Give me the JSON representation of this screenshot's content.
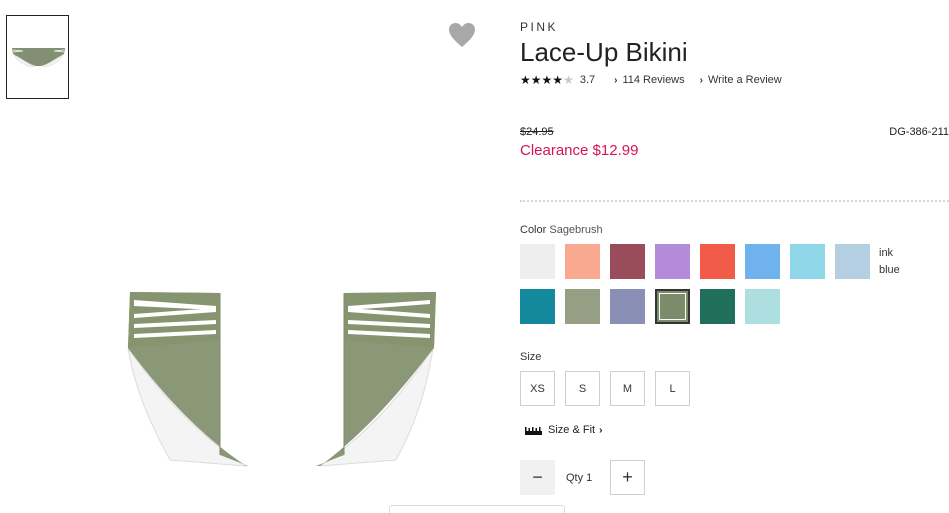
{
  "product": {
    "brand": "PINK",
    "title": "Lace-Up Bikini",
    "rating_stars_filled": 4,
    "rating_stars_total": 5,
    "rating_value": "3.7",
    "reviews_link": "114 Reviews",
    "write_review_link": "Write a Review",
    "original_price": "$24.95",
    "sale_price": "Clearance $12.99",
    "sku": "DG-386-211"
  },
  "color": {
    "label": "Color",
    "selected": "Sagebrush",
    "tooltip_line1": "ink",
    "tooltip_line2": "blue",
    "swatches_row1": [
      {
        "name": "white-marble",
        "color": "#eeeeee"
      },
      {
        "name": "coral",
        "color": "#f9a98f"
      },
      {
        "name": "plum",
        "color": "#9a4c5a"
      },
      {
        "name": "purple-floral",
        "color": "#b38bd8"
      },
      {
        "name": "red-tropical",
        "color": "#f25a4a"
      },
      {
        "name": "blue-watercolor",
        "color": "#6fb2ee"
      },
      {
        "name": "tie-dye",
        "color": "#8fd6e8"
      },
      {
        "name": "ink-blue",
        "color": "#b3cfe1"
      }
    ],
    "swatches_row2": [
      {
        "name": "teal",
        "color": "#14889c"
      },
      {
        "name": "sage",
        "color": "#969f84"
      },
      {
        "name": "feather-print",
        "color": "#8a8fb6"
      },
      {
        "name": "sagebrush",
        "color": "#7c8b6a",
        "selected": true
      },
      {
        "name": "green-palm",
        "color": "#1f6f5c"
      },
      {
        "name": "aqua",
        "color": "#addfe1"
      }
    ]
  },
  "size": {
    "label": "Size",
    "options": [
      "XS",
      "S",
      "M",
      "L"
    ],
    "size_fit_link": "Size & Fit"
  },
  "quantity": {
    "minus": "−",
    "label": "Qty 1",
    "plus": "+"
  }
}
